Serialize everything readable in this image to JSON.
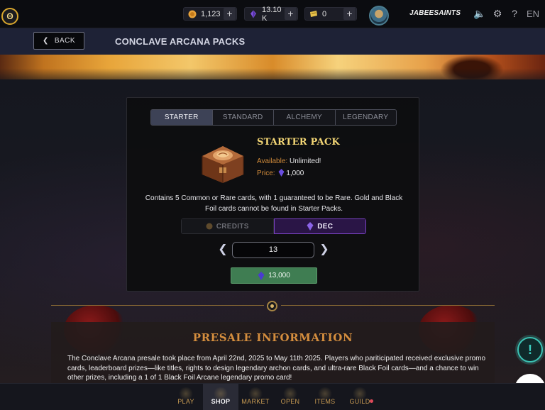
{
  "topbar": {
    "logo_glyph": "ʘ",
    "resources": [
      {
        "name": "credits",
        "value": "1,123",
        "icon": "credits-coin-icon",
        "color": "#e8a23a"
      },
      {
        "name": "dec",
        "value": "13.10 K",
        "icon": "dec-crystal-icon",
        "color": "#7a4fd6"
      },
      {
        "name": "vouchers",
        "value": "0",
        "icon": "voucher-ticket-icon",
        "color": "#e8c24a"
      }
    ],
    "plus_label": "+",
    "username": "JABEESAINTS",
    "sound_glyph": "🔈",
    "settings_glyph": "⚙",
    "help_glyph": "?",
    "language": "EN"
  },
  "header": {
    "back_label": "BACK",
    "back_glyph": "❮",
    "title": "CONCLAVE ARCANA PACKS"
  },
  "pack": {
    "tabs": [
      {
        "label": "STARTER",
        "active": true
      },
      {
        "label": "STANDARD",
        "active": false
      },
      {
        "label": "ALCHEMY",
        "active": false
      },
      {
        "label": "LEGENDARY",
        "active": false
      }
    ],
    "name": "STARTER PACK",
    "available_label": "Available:",
    "available_value": "Unlimited!",
    "price_label": "Price:",
    "price_value": "1,000",
    "description": "Contains 5 Common or Rare cards, with 1 guaranteed to be Rare. Gold and Black Foil cards cannot be found in Starter Packs.",
    "currency_options": [
      {
        "label": "CREDITS",
        "selected": false
      },
      {
        "label": "DEC",
        "selected": true
      }
    ],
    "quantity": "13",
    "prev_glyph": "❮",
    "next_glyph": "❯",
    "total": "13,000"
  },
  "presale": {
    "title": "PRESALE INFORMATION",
    "text": "The Conclave Arcana presale took place from April 22nd, 2025 to May 11th 2025. Players who pariticipated received exclusive promo cards, leaderboard prizes—like titles, rights to design legendary archon cards, and ultra-rare Black Foil cards—and a chance to win other prizes, including a 1 of 1 Black Foil Arcane legendary promo card!"
  },
  "floating": {
    "info_glyph": "!"
  },
  "bottom_nav": [
    {
      "label": "PLAY",
      "active": false
    },
    {
      "label": "SHOP",
      "active": true
    },
    {
      "label": "MARKET",
      "active": false
    },
    {
      "label": "OPEN",
      "active": false
    },
    {
      "label": "ITEMS",
      "active": false
    },
    {
      "label": "GUILD",
      "active": false,
      "notification": true
    }
  ],
  "colors": {
    "accent_gold": "#f3d675",
    "dec_purple": "#7a43c2",
    "buy_green": "#3f7d52",
    "label_orange": "#d08a3a"
  }
}
